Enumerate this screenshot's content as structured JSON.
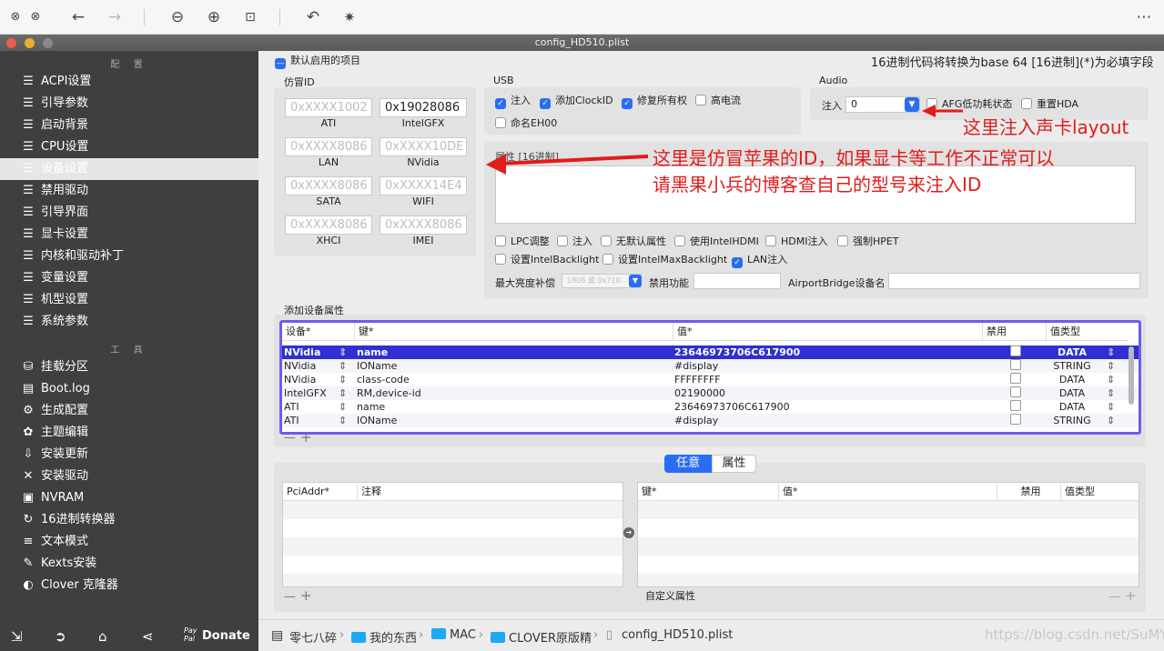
{
  "viewer": {
    "icons": [
      "close-icon",
      "close-icon",
      "back-arrow-icon",
      "forward-arrow-icon",
      "zoom-out-icon",
      "zoom-in-icon",
      "fit-icon",
      "rotate-icon",
      "magic-wand-icon",
      "more-icon"
    ]
  },
  "window": {
    "title": "config_HD510.plist"
  },
  "sidebar": {
    "section_config": "配 置",
    "items": [
      "ACPI设置",
      "引导参数",
      "启动背景",
      "CPU设置",
      "设备设置",
      "禁用驱动",
      "引导界面",
      "显卡设置",
      "内核和驱动补丁",
      "变量设置",
      "机型设置",
      "系统参数"
    ],
    "section_tools": "工 具",
    "tools": [
      "挂载分区",
      "Boot.log",
      "生成配置",
      "主题编辑",
      "安装更新",
      "安装驱动",
      "NVRAM",
      "16进制转换器",
      "文本模式",
      "Kexts安装",
      "Clover 克隆器"
    ],
    "donate": "Donate",
    "paypal": "Pay Pal"
  },
  "main": {
    "default_enable": "默认启用的项目",
    "hex_note": "16进制代码将转换为base 64 [16进制](*)为必填字段",
    "fake_id_title": "仿冒ID",
    "fake_ids": [
      {
        "label": "ATI",
        "value": "",
        "placeholder": "0xXXXX1002"
      },
      {
        "label": "IntelGFX",
        "value": "0x19028086",
        "placeholder": ""
      },
      {
        "label": "LAN",
        "value": "",
        "placeholder": "0xXXXX8086"
      },
      {
        "label": "NVidia",
        "value": "",
        "placeholder": "0xXXXX10DE"
      },
      {
        "label": "SATA",
        "value": "",
        "placeholder": "0xXXXX8086"
      },
      {
        "label": "WIFI",
        "value": "",
        "placeholder": "0xXXXX14E4"
      },
      {
        "label": "XHCI",
        "value": "",
        "placeholder": "0xXXXX8086"
      },
      {
        "label": "IMEI",
        "value": "",
        "placeholder": "0xXXXX8086"
      }
    ],
    "usb_title": "USB",
    "usb": [
      {
        "label": "注入",
        "checked": true
      },
      {
        "label": "添加ClockID",
        "checked": true
      },
      {
        "label": "修复所有权",
        "checked": true
      },
      {
        "label": "高电流",
        "checked": false
      },
      {
        "label": "命名EH00",
        "checked": false
      }
    ],
    "audio_title": "Audio",
    "audio_inject_label": "注入",
    "audio_inject_value": "0",
    "afg": "AFG低功耗状态",
    "reset_hda": "重置HDA",
    "props_hex_label": "属性 [16进制]",
    "checks_row1": [
      "LPC调整",
      "注入",
      "无默认属性",
      "使用IntelHDMI",
      "HDMI注入",
      "强制HPET"
    ],
    "checks_row2": [
      "设置IntelBacklight",
      "设置IntelMaxBacklight",
      "LAN注入"
    ],
    "max_bright_label": "最大亮度补偿",
    "max_bright_placeholder": "1808 或 0x710",
    "disable_func_label": "禁用功能",
    "airport_label": "AirportBridge设备名",
    "add_props_title": "添加设备属性",
    "table_headers": [
      "设备*",
      "键*",
      "值*",
      "禁用",
      "值类型"
    ],
    "table_rows": [
      {
        "device": "NVidia",
        "key": "name",
        "value": "23646973706C617900",
        "type": "DATA"
      },
      {
        "device": "NVidia",
        "key": "IOName",
        "value": "#display",
        "type": "STRING"
      },
      {
        "device": "NVidia",
        "key": "class-code",
        "value": "FFFFFFFF",
        "type": "DATA"
      },
      {
        "device": "IntelGFX",
        "key": "RM,device-id",
        "value": "02190000",
        "type": "DATA"
      },
      {
        "device": "ATI",
        "key": "name",
        "value": "23646973706C617900",
        "type": "DATA"
      },
      {
        "device": "ATI",
        "key": "IOName",
        "value": "#display",
        "type": "STRING"
      }
    ],
    "seg_any": "任意",
    "seg_props": "属性",
    "pci_headers": [
      "PciAddr*",
      "注释"
    ],
    "kv_headers": [
      "键*",
      "值*",
      "禁用",
      "值类型"
    ],
    "custom_props": "自定义属性",
    "plus": "+",
    "minus": "—"
  },
  "status": {
    "path": [
      "零七八碎",
      "我的东西",
      "MAC",
      "CLOVER原版精",
      "config_HD510.plist"
    ]
  },
  "annotations": {
    "audio": "这里注入声卡layout",
    "fake_line1": "这里是仿冒苹果的ID，如果显卡等工作不正常可以",
    "fake_line2": "请黑果小兵的博客查自己的型号来注入ID"
  },
  "watermark": "https://blog.csdn.net/SuMYi",
  "colors": {
    "accent": "#2a6df4",
    "selection": "#2f2fd4",
    "annotation": "#e21b1b",
    "sidebar": "#3f3f3f"
  }
}
